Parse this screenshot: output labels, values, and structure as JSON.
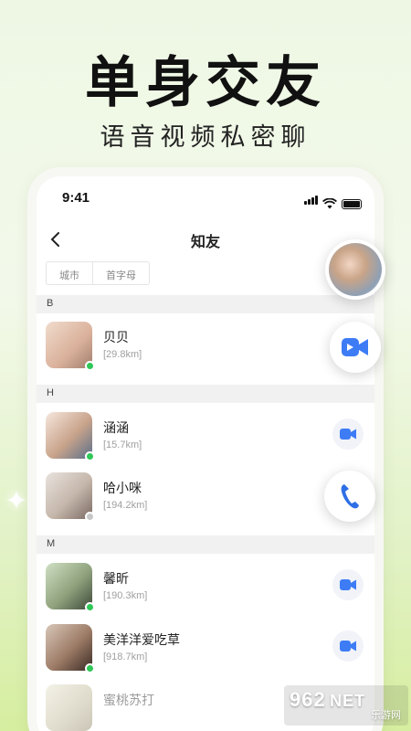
{
  "promo": {
    "title": "单身交友",
    "subtitle": "语音视频私密聊"
  },
  "status_bar": {
    "time": "9:41",
    "icons": [
      "signal-icon",
      "wifi-icon",
      "battery-icon"
    ]
  },
  "nav": {
    "back_icon": "chevron-left-icon",
    "title": "知友"
  },
  "filter_tabs": [
    {
      "label": "城市"
    },
    {
      "label": "首字母"
    }
  ],
  "sections": [
    {
      "letter": "B"
    },
    {
      "letter": "H"
    },
    {
      "letter": "M"
    }
  ],
  "contacts": [
    {
      "name": "贝贝",
      "distance": "[29.8km]",
      "online": true
    },
    {
      "name": "涵涵",
      "distance": "[15.7km]",
      "online": true
    },
    {
      "name": "哈小咪",
      "distance": "[194.2km]",
      "online": false
    },
    {
      "name": "馨昕",
      "distance": "[190.3km]",
      "online": true
    },
    {
      "name": "美洋洋爱吃草",
      "distance": "[918.7km]",
      "online": true
    },
    {
      "name": "蜜桃苏打",
      "distance": "",
      "online": false
    }
  ],
  "floating_buttons": {
    "profile": "avatar",
    "video": "video-camera-icon",
    "call": "phone-icon"
  },
  "colors": {
    "accent_blue": "#3d7cf5",
    "online_green": "#2fc757",
    "call_blue": "#2f6fe6"
  },
  "watermark": {
    "text": "962",
    "suffix": "NET",
    "subtitle": "乐游网"
  }
}
